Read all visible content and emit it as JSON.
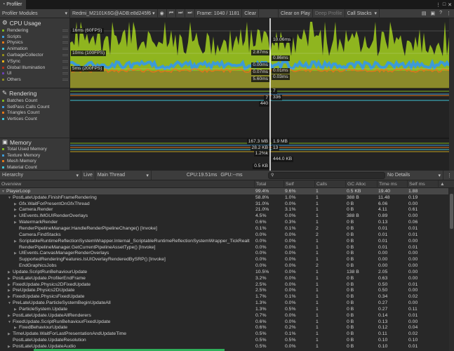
{
  "window": {
    "title": "Profiler",
    "controls": [
      "⋮",
      "□",
      "✕"
    ]
  },
  "toolbar": {
    "modules": "Profiler Modules",
    "device": "Redmi_M2101K6G@ADB:e8d245f6",
    "frame": "Frame: 1040 / 1181",
    "clear": "Clear",
    "clear_on_play": "Clear on Play",
    "deep_profile": "Deep Profile",
    "call_stacks": "Call Stacks"
  },
  "modules": [
    {
      "title": "CPU Usage",
      "items": [
        {
          "label": "Rendering",
          "color": "#7fb21c"
        },
        {
          "label": "Scripts",
          "color": "#3d9ad6"
        },
        {
          "label": "Physics",
          "color": "#e0761a"
        },
        {
          "label": "Animation",
          "color": "#3fc3d6"
        },
        {
          "label": "GarbageCollector",
          "color": "#8f8a1b"
        },
        {
          "label": "VSync",
          "color": "#e8b21a"
        },
        {
          "label": "Global Illumination",
          "color": "#b0301c"
        },
        {
          "label": "UI",
          "color": "#6a3fb0"
        },
        {
          "label": "Others",
          "color": "#8a8a23"
        }
      ]
    },
    {
      "title": "Rendering",
      "items": [
        {
          "label": "Batches Count",
          "color": "#7fb21c"
        },
        {
          "label": "SetPass Calls Count",
          "color": "#3d9ad6"
        },
        {
          "label": "Triangles Count",
          "color": "#e0761a"
        },
        {
          "label": "Vertices Count",
          "color": "#3fc3d6"
        }
      ]
    },
    {
      "title": "Memory",
      "items": [
        {
          "label": "Total Used Memory",
          "color": "#7fb21c"
        },
        {
          "label": "Texture Memory",
          "color": "#3d9ad6"
        },
        {
          "label": "Mesh Memory",
          "color": "#e0761a"
        },
        {
          "label": "Material Count",
          "color": "#3fc3d6"
        }
      ]
    }
  ],
  "cpu_chart": {
    "fps_lines": [
      "16ms (60FPS)",
      "10ms (100FPS)",
      "5ms (200FPS)"
    ],
    "left_labels": [
      "2.87ms",
      "0.00ms",
      "0.07ms",
      "5.60ms"
    ],
    "right_labels": [
      "10.06ms",
      "0.86ms",
      "0.01ms",
      "0.03ms"
    ]
  },
  "rendering_chart": {
    "left_labels": [
      "7",
      "440"
    ],
    "right_labels": [
      "7",
      "336"
    ]
  },
  "memory_chart": {
    "left_labels": [
      "167.3 MB",
      "28.2 KB",
      "1.2%k",
      "0.5 KB"
    ],
    "right_labels": [
      "1.9 MB",
      "13",
      "444.0 KB"
    ]
  },
  "hierarchy": {
    "view": "Hierarchy",
    "live": "Live",
    "thread": "Main Thread",
    "cpu": "CPU:19.51ms",
    "gpu": "GPU:--ms",
    "details": "No Details",
    "columns": [
      "Overview",
      "Total",
      "Self",
      "Calls",
      "GC Alloc",
      "Time ms",
      "Self ms"
    ],
    "rows": [
      {
        "name": "PlayerLoop",
        "d": 0,
        "a": "▼",
        "v": [
          "99.4%",
          "9.6%",
          "1",
          "0.5 KB",
          "19.40",
          "1.88"
        ]
      },
      {
        "name": "PostLateUpdate.FinishFrameRendering",
        "d": 1,
        "a": "▼",
        "v": [
          "58.8%",
          "1.0%",
          "1",
          "388 B",
          "11.48",
          "0.19"
        ]
      },
      {
        "name": "Gfx.WaitForPresentOnGfxThread",
        "d": 2,
        "a": "▶",
        "v": [
          "31.0%",
          "0.0%",
          "1",
          "0 B",
          "6.06",
          "0.00"
        ]
      },
      {
        "name": "Camera.Render",
        "d": 2,
        "a": "▶",
        "v": [
          "21.0%",
          "3.1%",
          "1",
          "0 B",
          "4.11",
          "0.61"
        ]
      },
      {
        "name": "UIEvents.IMGUIRenderOverlays",
        "d": 2,
        "a": "▶",
        "v": [
          "4.5%",
          "0.0%",
          "1",
          "388 B",
          "0.89",
          "0.00"
        ]
      },
      {
        "name": "WatermarkRender",
        "d": 2,
        "a": "▶",
        "v": [
          "0.6%",
          "0.3%",
          "1",
          "0 B",
          "0.13",
          "0.06"
        ]
      },
      {
        "name": "RenderPipelineManager.HandleRenderPipelineChange() [Invoke]",
        "d": 2,
        "a": "",
        "v": [
          "0.1%",
          "0.1%",
          "2",
          "0 B",
          "0.01",
          "0.01"
        ]
      },
      {
        "name": "Camera.FindStacks",
        "d": 2,
        "a": "",
        "v": [
          "0.0%",
          "0.0%",
          "2",
          "0 B",
          "0.01",
          "0.01"
        ]
      },
      {
        "name": "ScriptableRuntimeReflectionSystemWrapper.Internal_ScriptableRuntimeReflectionSystemWrapper_TickRealt",
        "d": 2,
        "a": "▶",
        "v": [
          "0.0%",
          "0.0%",
          "1",
          "0 B",
          "0.01",
          "0.00"
        ]
      },
      {
        "name": "RenderPipelineManager.GetCurrentPipelineAssetType() [Invoke]",
        "d": 2,
        "a": "",
        "v": [
          "0.0%",
          "0.0%",
          "1",
          "0 B",
          "0.01",
          "0.01"
        ]
      },
      {
        "name": "UIEvents.CanvasManagerRenderOverlays",
        "d": 2,
        "a": "▶",
        "v": [
          "0.0%",
          "0.0%",
          "1",
          "0 B",
          "0.00",
          "0.00"
        ]
      },
      {
        "name": "SupportedRenderingFeatures.IsUIOverlayRenderedBySRP() [Invoke]",
        "d": 2,
        "a": "",
        "v": [
          "0.0%",
          "0.0%",
          "1",
          "0 B",
          "0.00",
          "0.00"
        ]
      },
      {
        "name": "EndGraphicsJobs",
        "d": 2,
        "a": "",
        "v": [
          "0.0%",
          "0.0%",
          "2",
          "0 B",
          "0.00",
          "0.00"
        ]
      },
      {
        "name": "Update.ScriptRunBehaviourUpdate",
        "d": 1,
        "a": "▶",
        "v": [
          "10.5%",
          "0.0%",
          "1",
          "138 B",
          "2.05",
          "0.00"
        ]
      },
      {
        "name": "PostLateUpdate.ProfilerEndFrame",
        "d": 1,
        "a": "▶",
        "v": [
          "3.2%",
          "0.0%",
          "1",
          "0 B",
          "0.63",
          "0.00"
        ]
      },
      {
        "name": "FixedUpdate.Physics2DFixedUpdate",
        "d": 1,
        "a": "▶",
        "v": [
          "2.5%",
          "0.0%",
          "1",
          "0 B",
          "0.50",
          "0.01"
        ]
      },
      {
        "name": "PreUpdate.Physics2DUpdate",
        "d": 1,
        "a": "▶",
        "v": [
          "2.5%",
          "0.0%",
          "1",
          "0 B",
          "0.50",
          "0.00"
        ]
      },
      {
        "name": "FixedUpdate.PhysicsFixedUpdate",
        "d": 1,
        "a": "▶",
        "v": [
          "1.7%",
          "0.1%",
          "1",
          "0 B",
          "0.34",
          "0.02"
        ]
      },
      {
        "name": "PreLateUpdate.ParticleSystemBeginUpdateAll",
        "d": 1,
        "a": "▼",
        "v": [
          "1.3%",
          "0.0%",
          "1",
          "0 B",
          "0.27",
          "0.00"
        ]
      },
      {
        "name": "ParticleSystem.Update",
        "d": 2,
        "a": "▶",
        "v": [
          "1.3%",
          "0.5%",
          "1",
          "0 B",
          "0.27",
          "0.11"
        ]
      },
      {
        "name": "PostLateUpdate.UpdateAllRenderers",
        "d": 1,
        "a": "▶",
        "v": [
          "0.7%",
          "0.0%",
          "1",
          "0 B",
          "0.14",
          "0.01"
        ]
      },
      {
        "name": "FixedUpdate.ScriptRunBehaviourFixedUpdate",
        "d": 1,
        "a": "▼",
        "v": [
          "0.6%",
          "0.0%",
          "1",
          "0 B",
          "0.13",
          "0.00"
        ]
      },
      {
        "name": "FixedBehaviourUpdate",
        "d": 2,
        "a": "▶",
        "v": [
          "0.6%",
          "0.2%",
          "1",
          "0 B",
          "0.12",
          "0.04"
        ]
      },
      {
        "name": "TimeUpdate.WaitForLastPresentationAndUpdateTime",
        "d": 1,
        "a": "▶",
        "v": [
          "0.5%",
          "0.1%",
          "1",
          "0 B",
          "0.11",
          "0.02"
        ]
      },
      {
        "name": "PostLateUpdate.UpdateResolution",
        "d": 1,
        "a": "",
        "v": [
          "0.5%",
          "0.5%",
          "1",
          "0 B",
          "0.10",
          "0.10"
        ]
      },
      {
        "name": "PostLateUpdate.UpdateAudio",
        "d": 1,
        "a": "▶",
        "v": [
          "0.5%",
          "0.0%",
          "1",
          "0 B",
          "0.10",
          "0.01"
        ]
      }
    ]
  }
}
